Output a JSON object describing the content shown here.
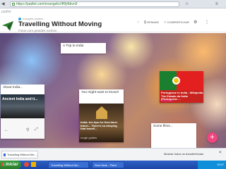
{
  "browser": {
    "url": "https://padlet.com/evangelic/4f9j4tbvn9",
    "nav_icons": [
      "back-icon",
      "forward-icon",
      "reload-icon"
    ]
  },
  "header": {
    "logo": "padlet",
    "creator": "evangelic padlets",
    "title": "Travelling Without Moving",
    "subtitle": "Fotos com grandes sonhos",
    "buttons": [
      "REMAKE",
      "COMPARTILHAR"
    ]
  },
  "cards": {
    "trip": {
      "title": "A Trip to India"
    },
    "about": {
      "title": "About India...",
      "video_title": "Ancient India and it..."
    },
    "might": {
      "title": "You might want to know!!",
      "thumb_text": "India: ten tips for first-timer travel... There's no denying that travell...",
      "source": "rough guides"
    },
    "portugal": {
      "thumb_text": "Portuguese in India - Wikipedia The Estado da Índia (Portuguese ...",
      "source": "wikipedia"
    },
    "films": {
      "title": "Some films..."
    }
  },
  "fab": {
    "label": "+"
  },
  "downloads": {
    "item": "Travelling Without Mo....html",
    "show_all": "Mostrar todos os transferências",
    "close": "×"
  },
  "taskbar": {
    "start": "Iniciar",
    "tasks": [
      "Travelling Without Mo...",
      "Sem título - Paint"
    ],
    "clock": "16:57"
  },
  "colors": {
    "accent": "#f0457e",
    "brand": "#2d7d2f"
  }
}
